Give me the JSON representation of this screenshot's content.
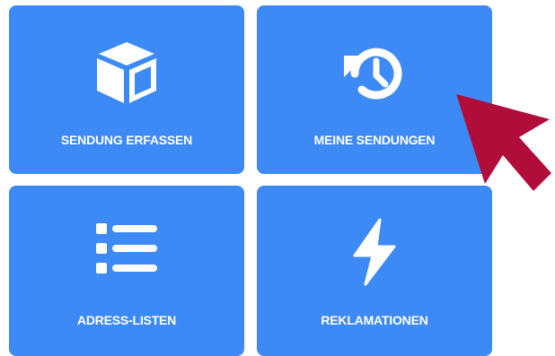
{
  "tiles": [
    {
      "label": "SENDUNG ERFASSEN",
      "icon": "cube-icon"
    },
    {
      "label": "MEINE SENDUNGEN",
      "icon": "history-icon"
    },
    {
      "label": "ADRESS-LISTEN",
      "icon": "list-icon"
    },
    {
      "label": "REKLAMATIONEN",
      "icon": "lightning-icon"
    }
  ],
  "colors": {
    "tile": "#3d8af7",
    "tile_text": "#ffffff",
    "pointer_arrow": "#b00d3b"
  },
  "pointer": {
    "icon": "pointer-arrow-icon"
  }
}
